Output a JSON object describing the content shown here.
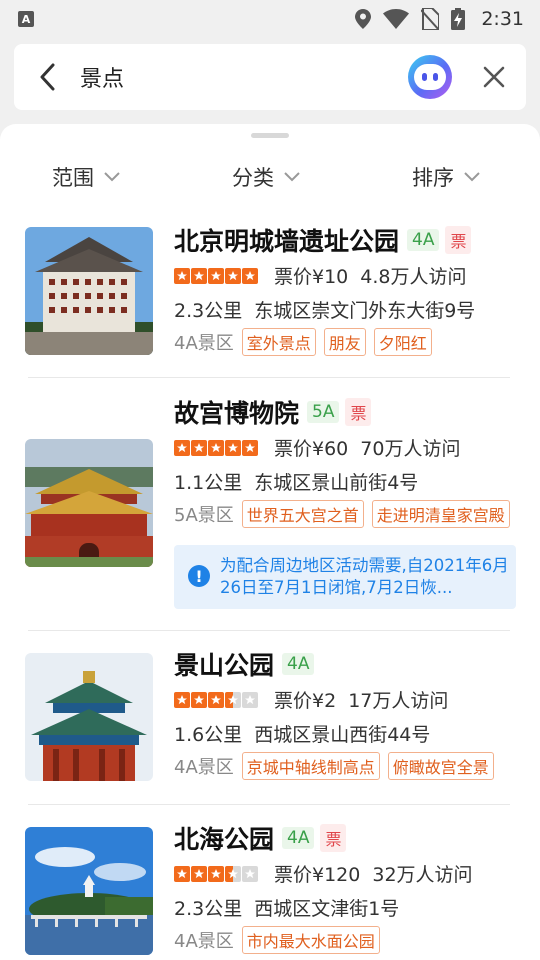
{
  "status_bar": {
    "time": "2:31"
  },
  "search": {
    "query": "景点"
  },
  "filters": {
    "range": "范围",
    "category": "分类",
    "sort": "排序"
  },
  "items": [
    {
      "name": "北京明城墙遗址公园",
      "level": "4A",
      "ticket": "票",
      "rating": 5,
      "price": "票价¥10",
      "visits": "4.8万人访问",
      "distance": "2.3公里",
      "address": "东城区崇文门外东大街9号",
      "grade": "4A景区",
      "features": [
        "室外景点",
        "朋友",
        "夕阳红"
      ]
    },
    {
      "name": "故宫博物院",
      "level": "5A",
      "ticket": "票",
      "rating": 5,
      "price": "票价¥60",
      "visits": "70万人访问",
      "distance": "1.1公里",
      "address": "东城区景山前街4号",
      "grade": "5A景区",
      "features": [
        "世界五大宫之首",
        "走进明清皇家宫殿"
      ],
      "notice": "为配合周边地区活动需要,自2021年6月26日至7月1日闭馆,7月2日恢..."
    },
    {
      "name": "景山公园",
      "level": "4A",
      "rating": 3.5,
      "price": "票价¥2",
      "visits": "17万人访问",
      "distance": "1.6公里",
      "address": "西城区景山西街44号",
      "grade": "4A景区",
      "features": [
        "京城中轴线制高点",
        "俯瞰故宫全景"
      ]
    },
    {
      "name": "北海公园",
      "level": "4A",
      "ticket": "票",
      "rating": 3.5,
      "price": "票价¥120",
      "visits": "32万人访问",
      "distance": "2.3公里",
      "address": "西城区文津街1号",
      "grade": "4A景区",
      "features": [
        "市内最大水面公园"
      ]
    }
  ],
  "colors": {
    "star_on": "#f26a1b",
    "star_off": "#d9d9d9",
    "level_green": "#3aa04a",
    "ticket_red": "#e0454a",
    "feature_orange": "#e0601f",
    "notice_blue": "#1f82e6"
  },
  "icons": [
    "back-arrow-icon",
    "assistant-robot-icon",
    "close-icon",
    "chevron-down-icon",
    "star-icon",
    "info-icon",
    "location-icon",
    "wifi-icon",
    "no-sim-icon",
    "battery-icon"
  ]
}
